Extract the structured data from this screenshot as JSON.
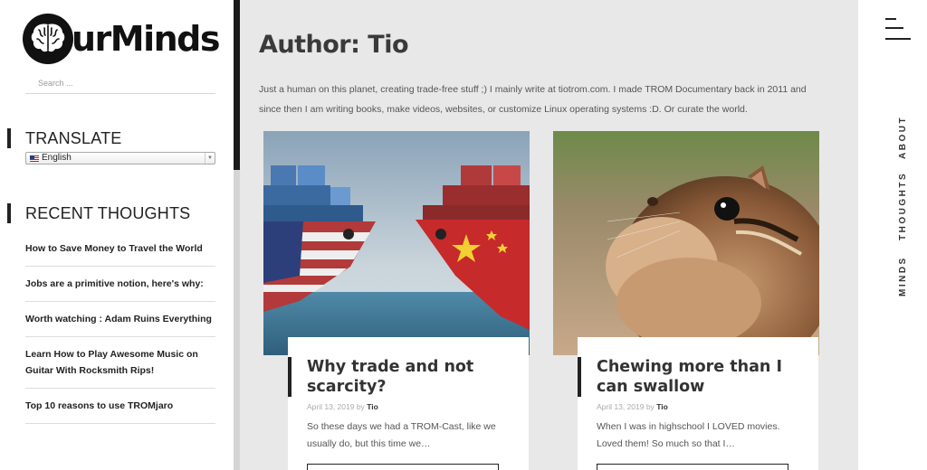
{
  "sidebar": {
    "logo_text": "urMinds",
    "search_placeholder": "Search ...",
    "translate_title": "TRANSLATE",
    "language": "English",
    "recent_title": "RECENT THOUGHTS",
    "recent_items": [
      "How to Save Money to Travel the World",
      "Jobs are a primitive notion, here's why:",
      "Worth watching : Adam Ruins Everything",
      "Learn How to Play Awesome Music on Guitar With Rocksmith Rips!",
      "Top 10 reasons to use TROMjaro"
    ]
  },
  "main": {
    "title": "Author: Tio",
    "bio": "Just a human on this planet, creating trade-free stuff ;) I mainly write at tiotrom.com. I made TROM Documentary back in 2011 and since then I am writing books, make videos, websites, or customize Linux operating systems :D. Or curate the world.",
    "posts": [
      {
        "title": "Why trade and not scarcity?",
        "date": "April 13, 2019",
        "by": "by",
        "author": "Tio",
        "excerpt": "So these days we had a TROM-Cast, like we usually do, but this time we…",
        "image": "cargo-ships-usa-china"
      },
      {
        "title": "Chewing more than I can swallow",
        "date": "April 13, 2019",
        "by": "by",
        "author": "Tio",
        "excerpt": "When I was in highschool I LOVED movies. Loved them! So much so that I…",
        "image": "chipmunk"
      }
    ]
  },
  "rightnav": {
    "items": [
      "ABOUT",
      "THOUGHTS",
      "MINDS"
    ]
  },
  "colors": {
    "background": "#e8e8e8",
    "accent": "#222222"
  }
}
